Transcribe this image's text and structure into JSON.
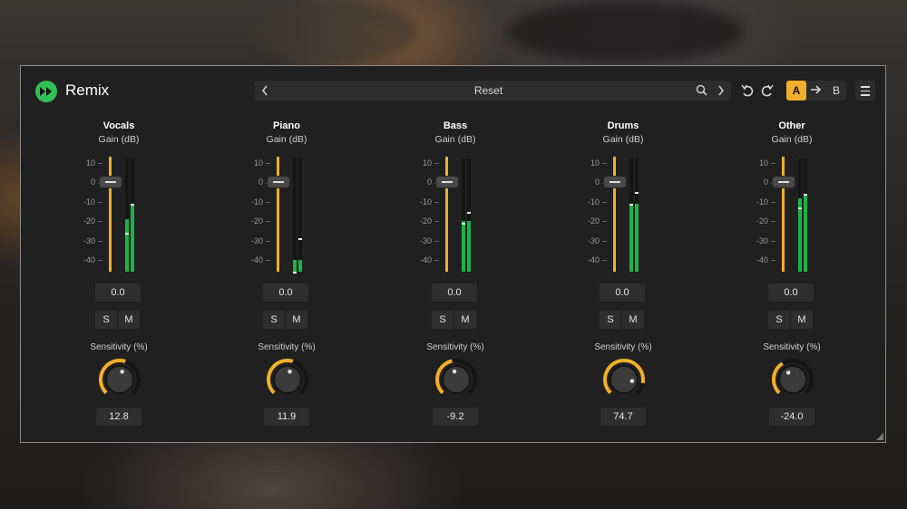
{
  "app": {
    "title": "Remix"
  },
  "preset": {
    "name": "Reset",
    "prev_icon": "chevron-left-icon",
    "next_icon": "chevron-right-icon",
    "search_icon": "search-icon"
  },
  "toolbar": {
    "undo_icon": "undo-icon",
    "redo_icon": "redo-icon",
    "a_label": "A",
    "arrow_icon": "arrow-right-icon",
    "b_label": "B",
    "menu_icon": "hamburger-menu-icon"
  },
  "colors": {
    "accent": "#f2ae2a",
    "meter": "#1db247",
    "logo": "#2fbf55",
    "panel": "#202020"
  },
  "scale_ticks": [
    "10",
    "0",
    "-10",
    "-20",
    "-30",
    "-40"
  ],
  "channels": [
    {
      "name": "Vocals",
      "gain_label": "Gain (dB)",
      "gain_value": "0.0",
      "meter_l_db": -19,
      "meter_r_db": -11,
      "peak_l_db": -26,
      "peak_r_db": -11,
      "solo": "S",
      "mute": "M",
      "sensitivity_label": "Sensitivity (%)",
      "sensitivity": "12.8",
      "sensitivity_num": 12.8
    },
    {
      "name": "Piano",
      "gain_label": "Gain (dB)",
      "gain_value": "0.0",
      "meter_l_db": -40,
      "meter_r_db": -40,
      "peak_l_db": -46,
      "peak_r_db": -29,
      "solo": "S",
      "mute": "M",
      "sensitivity_label": "Sensitivity (%)",
      "sensitivity": "11.9",
      "sensitivity_num": 11.9
    },
    {
      "name": "Bass",
      "gain_label": "Gain (dB)",
      "gain_value": "0.0",
      "meter_l_db": -20,
      "meter_r_db": -20,
      "peak_l_db": -21,
      "peak_r_db": -15,
      "solo": "S",
      "mute": "M",
      "sensitivity_label": "Sensitivity (%)",
      "sensitivity": "-9.2",
      "sensitivity_num": -9.2
    },
    {
      "name": "Drums",
      "gain_label": "Gain (dB)",
      "gain_value": "0.0",
      "meter_l_db": -11,
      "meter_r_db": -11,
      "peak_l_db": -11,
      "peak_r_db": -5,
      "solo": "S",
      "mute": "M",
      "sensitivity_label": "Sensitivity (%)",
      "sensitivity": "74.7",
      "sensitivity_num": 74.7
    },
    {
      "name": "Other",
      "gain_label": "Gain (dB)",
      "gain_value": "0.0",
      "meter_l_db": -8,
      "meter_r_db": -7,
      "peak_l_db": -13,
      "peak_r_db": -6,
      "solo": "S",
      "mute": "M",
      "sensitivity_label": "Sensitivity (%)",
      "sensitivity": "-24.0",
      "sensitivity_num": -24.0
    }
  ]
}
